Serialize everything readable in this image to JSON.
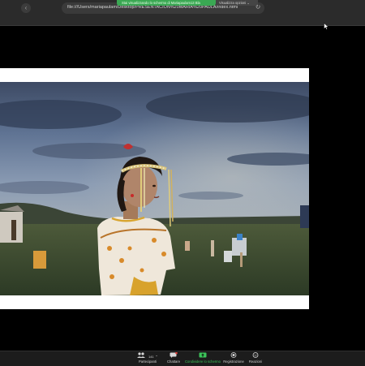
{
  "browser": {
    "url": "file:///Users/mariapaulam/Desktop/PRESENTACION%20MARIA%20PAULA/index.html",
    "back_glyph": "‹",
    "reload_glyph": "↻"
  },
  "share_banner": {
    "text": "Stai visualizzando lo schermo di Mariapaulam13 Bla",
    "view_options": "Visualizza opzioni ⌄"
  },
  "toolbar": {
    "participants_label": "Partecipanti",
    "participants_count": "141",
    "chat_label": "Chattare",
    "share_label": "Condividere lo schermo",
    "record_label": "Registrazione",
    "reactions_label": "Reazioni"
  },
  "colors": {
    "share_green": "#3aa853",
    "toolbar_bg": "#1c1c1c",
    "browser_bar_bg": "#2b2b2b"
  }
}
